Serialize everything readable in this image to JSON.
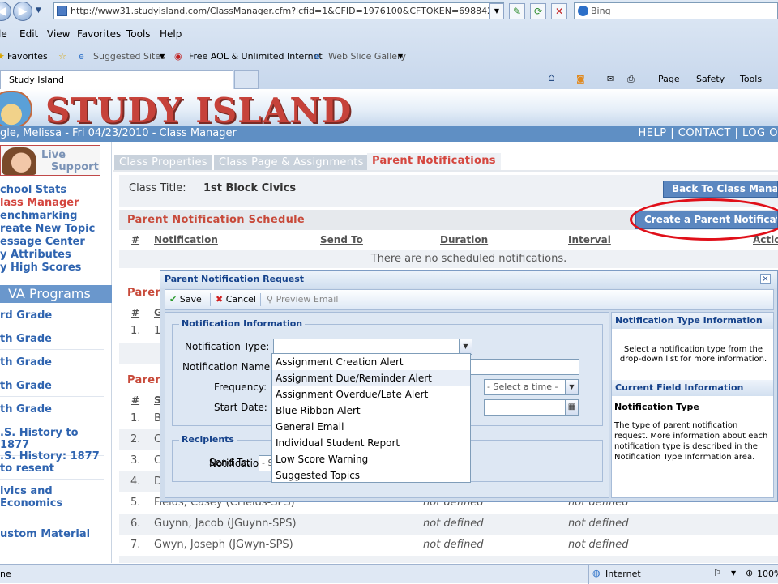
{
  "browser": {
    "url": "http://www31.studyisland.com/ClassManager.cfm?lcfid=1&CFID=1976100&CFTOKEN=69884201&pjidate=",
    "search_placeholder": "Bing",
    "menu": [
      "le",
      "Edit",
      "View",
      "Favorites",
      "Tools",
      "Help"
    ],
    "favorites": {
      "label": "Favorites",
      "suggested": "Suggested Sites",
      "aol": "Free AOL & Unlimited Internet",
      "web_slice": "Web Slice Gallery"
    },
    "tab_title": "Study Island",
    "commands": [
      "Page",
      "Safety",
      "Tools"
    ],
    "status_left": "ne",
    "status_zone": "Internet",
    "zoom": "100%"
  },
  "site": {
    "logo_text": "STUDY ISLAND",
    "user_line": "gle, Melissa - Fri 04/23/2010  -  Class Manager",
    "top_links": "HELP  |  CONTACT  |  LOG O"
  },
  "sidebar": {
    "live_support": [
      "Live",
      "Support"
    ],
    "links": [
      "chool Stats",
      "lass Manager",
      "enchmarking",
      "reate New Topic",
      "essage Center",
      "y Attributes",
      "y High Scores"
    ],
    "programs_header": "VA Programs",
    "grades": [
      "rd Grade",
      "th Grade",
      "th Grade",
      "th Grade",
      "th Grade",
      ".S. History to 1877",
      ".S. History: 1877 to resent",
      "ivics and Economics",
      "ustom Material"
    ]
  },
  "main": {
    "tabs": [
      "Class Properties",
      "Class Page & Assignments",
      "Parent Notifications"
    ],
    "class_title_label": "Class Title:",
    "class_title_value": "1st Block Civics",
    "back_button": "Back To Class Manage",
    "schedule_title": "Parent Notification Schedule",
    "create_button": "Create a Parent Notification",
    "columns": [
      "#",
      "Notification",
      "Send To",
      "Duration",
      "Interval",
      "Actio"
    ],
    "empty_message": "There are no scheduled notifications.",
    "section2_title": "Paren",
    "section2_col": [
      "#",
      "G"
    ],
    "section2_row": [
      "1.",
      "1"
    ],
    "section3_title": "Paren",
    "section3_col": [
      "#",
      "S"
    ],
    "rows": [
      {
        "n": "1.",
        "name": "B",
        "c1": "",
        "c2": ""
      },
      {
        "n": "2.",
        "name": "C",
        "c1": "",
        "c2": ""
      },
      {
        "n": "3.",
        "name": "C",
        "c1": "",
        "c2": ""
      },
      {
        "n": "4.",
        "name": "D",
        "c1": "",
        "c2": ""
      },
      {
        "n": "5.",
        "name": "Fields, Casey (CFields-SPS)",
        "c1": "not defined",
        "c2": "not defined"
      },
      {
        "n": "6.",
        "name": "Guynn, Jacob (JGuynn-SPS)",
        "c1": "not defined",
        "c2": "not defined"
      },
      {
        "n": "7.",
        "name": "Gwyn, Joseph (JGwyn-SPS)",
        "c1": "not defined",
        "c2": "not defined"
      }
    ]
  },
  "modal": {
    "title": "Parent Notification Request",
    "close": "×",
    "toolbar": {
      "save": "Save",
      "cancel": "Cancel",
      "preview": "Preview Email"
    },
    "notification_info_legend": "Notification Information",
    "labels": {
      "type": "Notification Type:",
      "name": "Notification Name:",
      "frequency": "Frequency:",
      "start": "Start Date:",
      "colon": ":"
    },
    "time_select": "- Select a time -",
    "recipients_legend": "Recipients",
    "send_to_label": "Send To:",
    "send_to_value": "- S",
    "dropdown_options": [
      "Assignment Creation Alert",
      "Assignment Due/Reminder Alert",
      "Assignment Overdue/Late Alert",
      "Blue Ribbon Alert",
      "General Email",
      "Individual Student Report",
      "Low Score Warning",
      "Suggested Topics"
    ],
    "type_info_header": "Notification Type Information",
    "type_info_text": "Select a notification type from the drop-down list for more information.",
    "field_info_header": "Current Field Information",
    "field_info_title": "Notification Type",
    "field_info_text": "The type of parent notification request. More information about each notification type is described in the Notification Type Information area."
  }
}
